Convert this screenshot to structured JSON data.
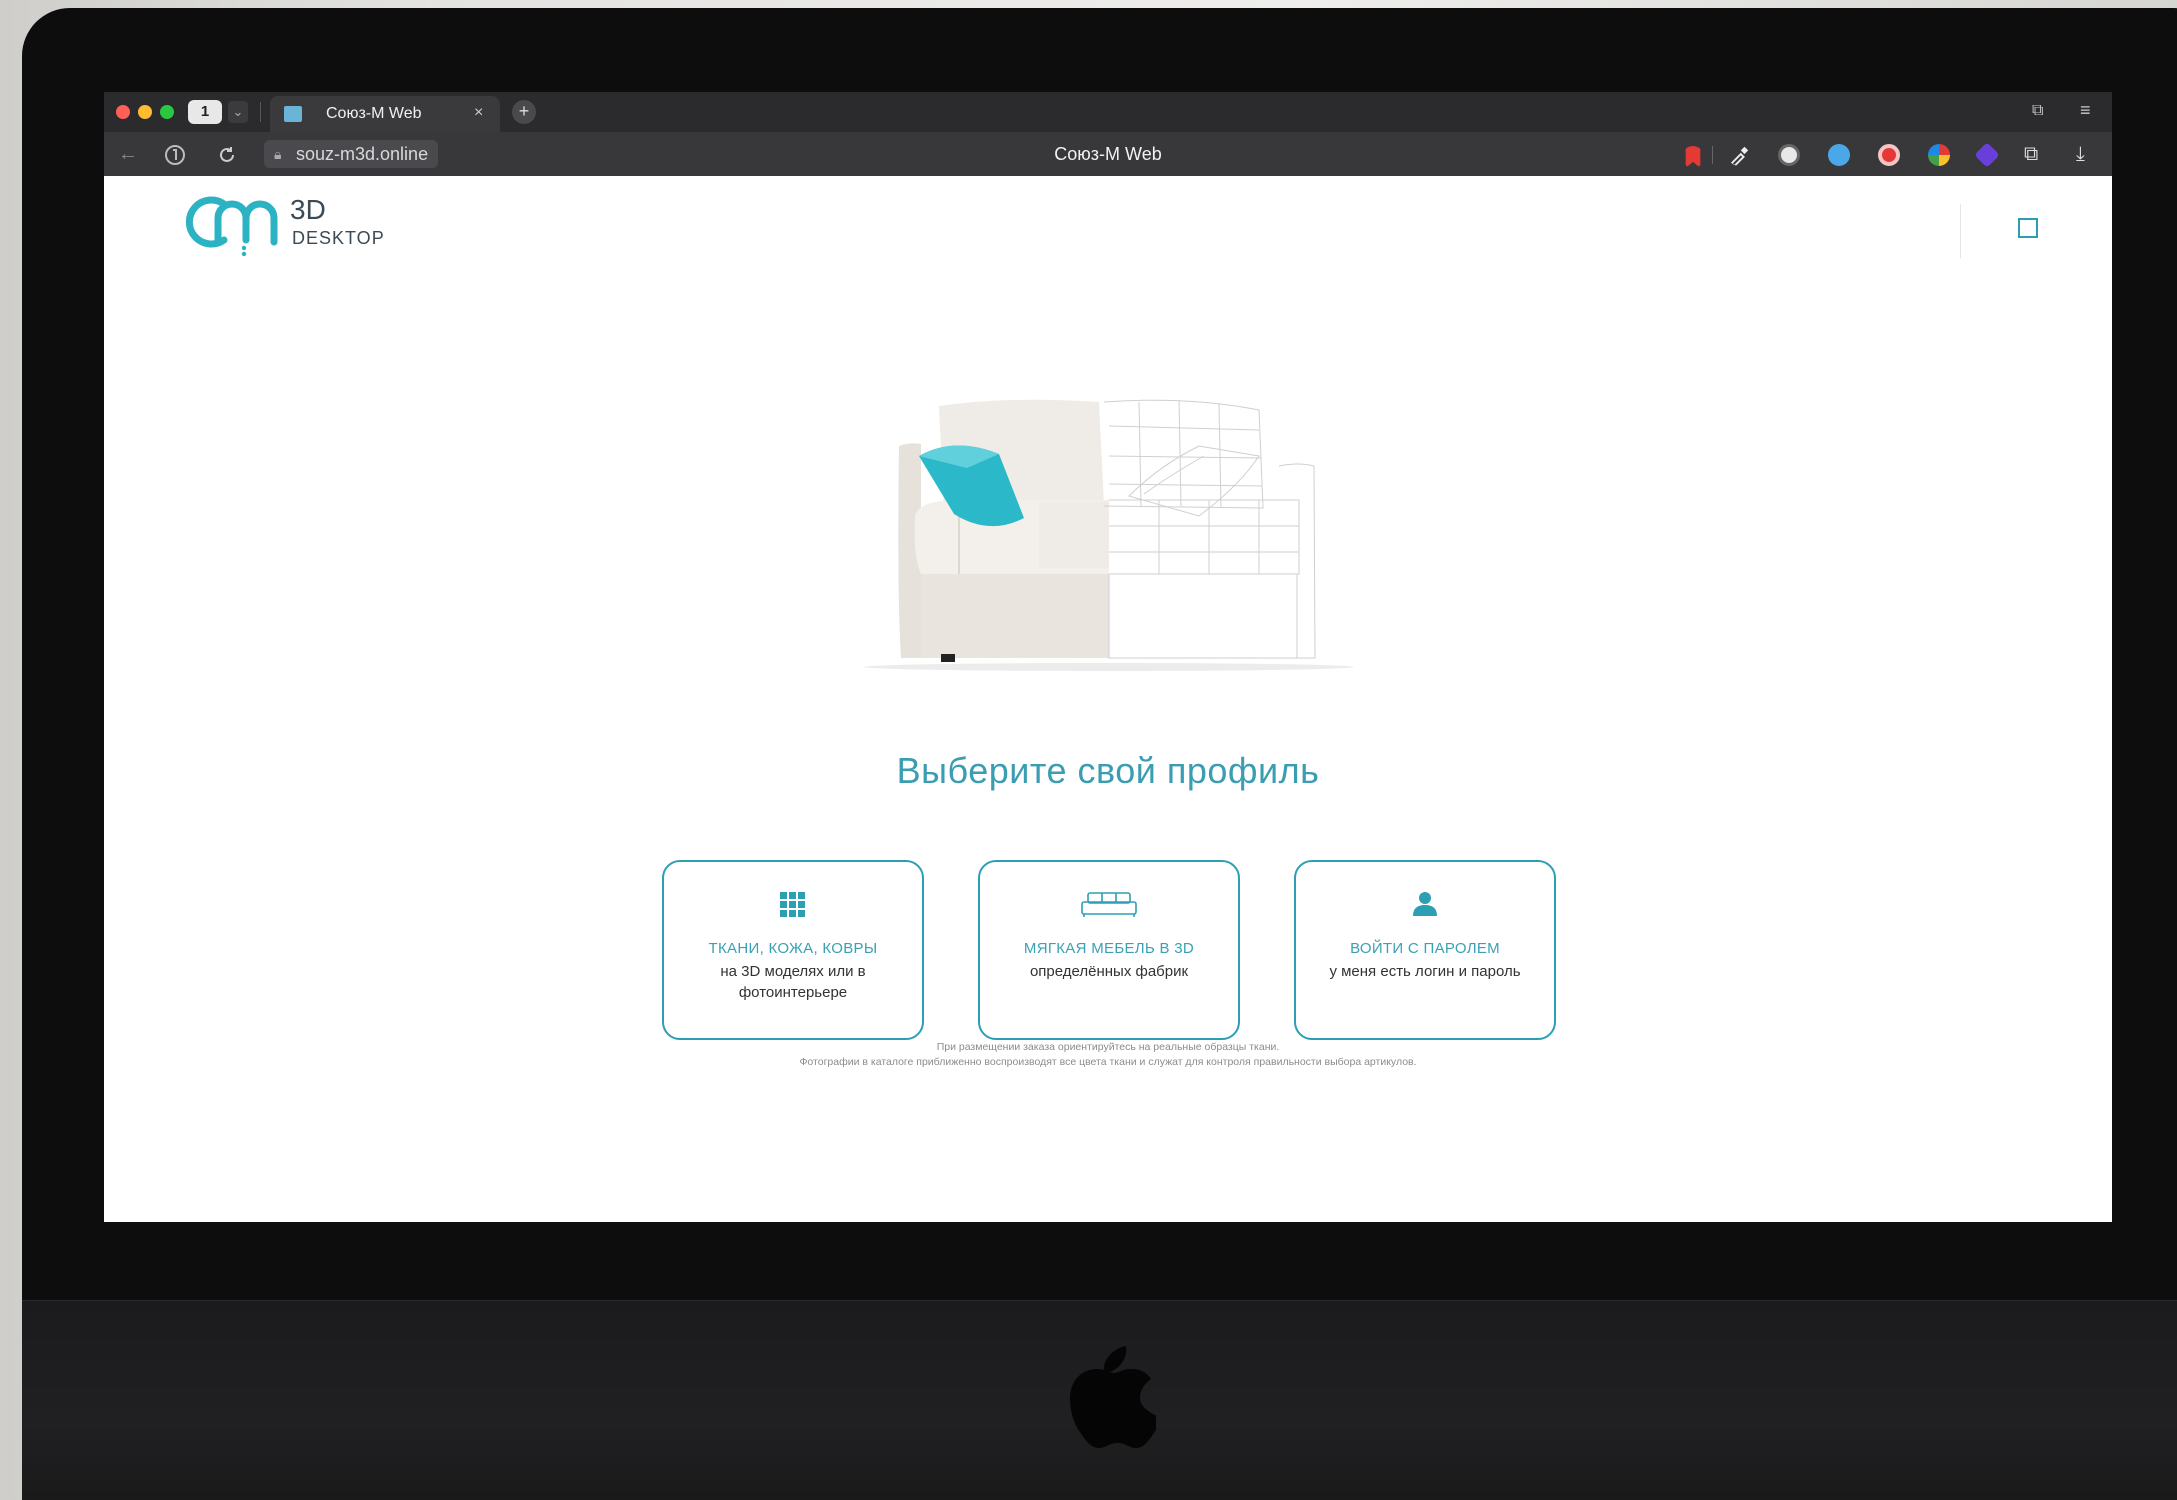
{
  "browser": {
    "tab_counter": "1",
    "tab_title": "Союз-М Web",
    "tab_close": "×",
    "new_tab": "+",
    "url": "souz-m3d.online",
    "window_title": "Союз-М Web"
  },
  "page": {
    "logo": {
      "line1": "3D",
      "line2": "DESKTOP"
    },
    "headline": "Выберите свой профиль",
    "cards": [
      {
        "icon": "grid-icon",
        "title": "ТКАНИ, КОЖА, КОВРЫ",
        "subtitle": "на 3D моделях или в фотоинтерьере"
      },
      {
        "icon": "sofa-icon",
        "title": "МЯГКАЯ МЕБЕЛЬ В 3D",
        "subtitle": "определённых фабрик"
      },
      {
        "icon": "user-icon",
        "title": "ВОЙТИ С ПАРОЛЕМ",
        "subtitle": "у меня есть логин и пароль"
      }
    ],
    "footnote_line1": "При размещении заказа ориентируйтесь на реальные образцы ткани.",
    "footnote_line2": "Фотографии в каталоге приближенно воспроизводят все цвета ткани и служат для контроля правильности выбора артикулов."
  },
  "colors": {
    "accent": "#2c9fb4",
    "headline": "#3a9db2",
    "pillow": "#2bb9c9"
  }
}
